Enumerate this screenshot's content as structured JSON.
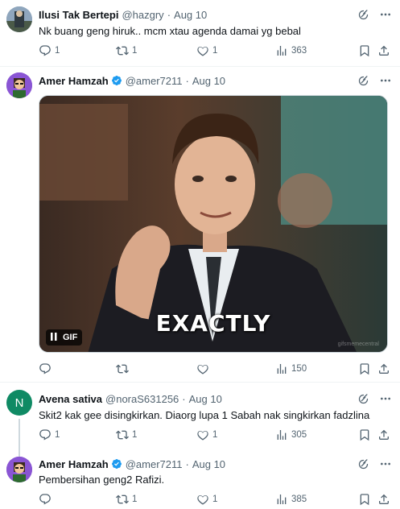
{
  "tweets": [
    {
      "name": "Ilusi Tak Bertepi",
      "handle": "@hazgry",
      "time": "Aug 10",
      "text": "Nk buang geng hiruk.. mcm xtau agenda damai yg bebal",
      "replies": "1",
      "retweets": "1",
      "likes": "1",
      "views": "363"
    },
    {
      "name": "Amer Hamzah",
      "handle": "@amer7211",
      "time": "Aug 10",
      "verified": true,
      "media": {
        "type": "GIF",
        "badge": "GIF",
        "caption": "EXACTLY",
        "watermark": "gifsmemecentral"
      },
      "replies": "",
      "retweets": "",
      "likes": "",
      "views": "150"
    },
    {
      "name": "Avena sativa",
      "handle": "@noraS631256",
      "time": "Aug 10",
      "avatar_letter": "N",
      "avatar_color": "#0f8a64",
      "text": "Skit2 kak gee disingkirkan. Diaorg lupa 1 Sabah nak singkirkan fadzlina",
      "replies": "1",
      "retweets": "1",
      "likes": "1",
      "views": "305"
    },
    {
      "name": "Amer Hamzah",
      "handle": "@amer7211",
      "time": "Aug 10",
      "verified": true,
      "text": "Pembersihan geng2 Rafizi.",
      "replies": "",
      "retweets": "1",
      "likes": "1",
      "views": "385"
    }
  ],
  "colors": {
    "accent": "#1d9bf0",
    "muted": "#536471",
    "divider": "#eff3f4"
  },
  "icons": [
    "reply-icon",
    "retweet-icon",
    "like-icon",
    "views-icon",
    "bookmark-icon",
    "share-icon",
    "grok-icon",
    "more-icon",
    "verified-icon",
    "pause-icon"
  ]
}
